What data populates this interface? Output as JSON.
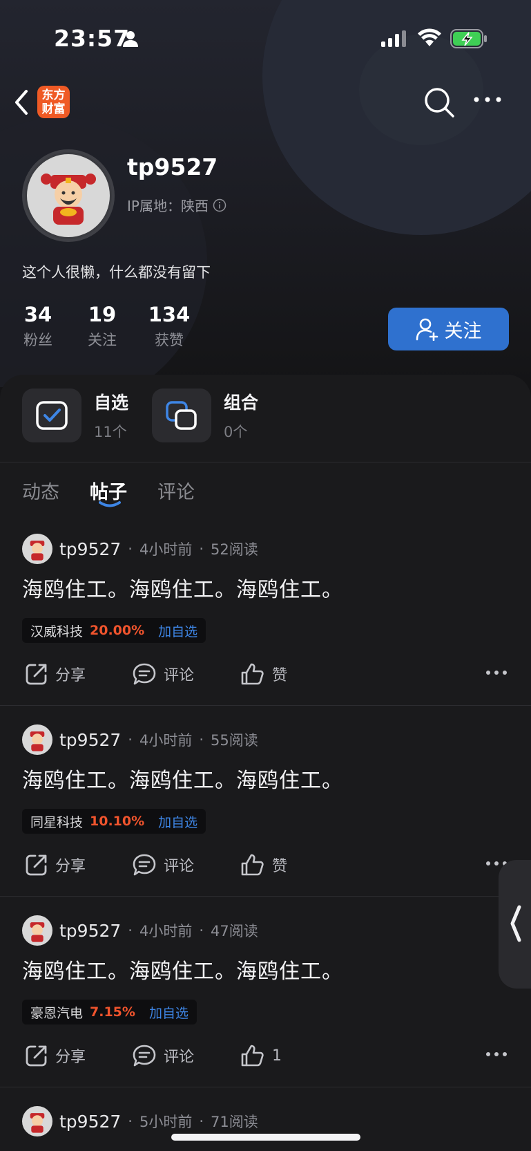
{
  "status_bar": {
    "time": "23:57"
  },
  "header": {
    "logo_line1": "东方",
    "logo_line2": "财富"
  },
  "profile": {
    "username": "tp9527",
    "ip_label": "IP属地：陕西",
    "bio": "这个人很懒，什么都没有留下",
    "stats": [
      {
        "value": "34",
        "label": "粉丝"
      },
      {
        "value": "19",
        "label": "关注"
      },
      {
        "value": "134",
        "label": "获赞"
      }
    ],
    "follow_label": "关注"
  },
  "cards": [
    {
      "title": "自选",
      "sub": "11个"
    },
    {
      "title": "组合",
      "sub": "0个"
    }
  ],
  "tabs": [
    {
      "label": "动态",
      "active": false
    },
    {
      "label": "帖子",
      "active": true
    },
    {
      "label": "评论",
      "active": false
    }
  ],
  "posts": [
    {
      "user": "tp9527",
      "time": "4小时前",
      "reads": "52阅读",
      "text": "海鸥住工。海鸥住工。海鸥住工。",
      "stock_name": "汉威科技",
      "stock_pct": "20.00%",
      "add_label": "加自选",
      "share": "分享",
      "comment": "评论",
      "like": "赞"
    },
    {
      "user": "tp9527",
      "time": "4小时前",
      "reads": "55阅读",
      "text": "海鸥住工。海鸥住工。海鸥住工。",
      "stock_name": "同星科技",
      "stock_pct": "10.10%",
      "add_label": "加自选",
      "share": "分享",
      "comment": "评论",
      "like": "赞"
    },
    {
      "user": "tp9527",
      "time": "4小时前",
      "reads": "47阅读",
      "text": "海鸥住工。海鸥住工。海鸥住工。",
      "stock_name": "豪恩汽电",
      "stock_pct": "7.15%",
      "add_label": "加自选",
      "share": "分享",
      "comment": "评论",
      "like": "1"
    },
    {
      "user": "tp9527",
      "time": "5小时前",
      "reads": "71阅读"
    }
  ],
  "colors": {
    "accent": "#2f71cf",
    "rise": "#f0542d",
    "link": "#3e86e6",
    "logo": "#ef5a25"
  }
}
